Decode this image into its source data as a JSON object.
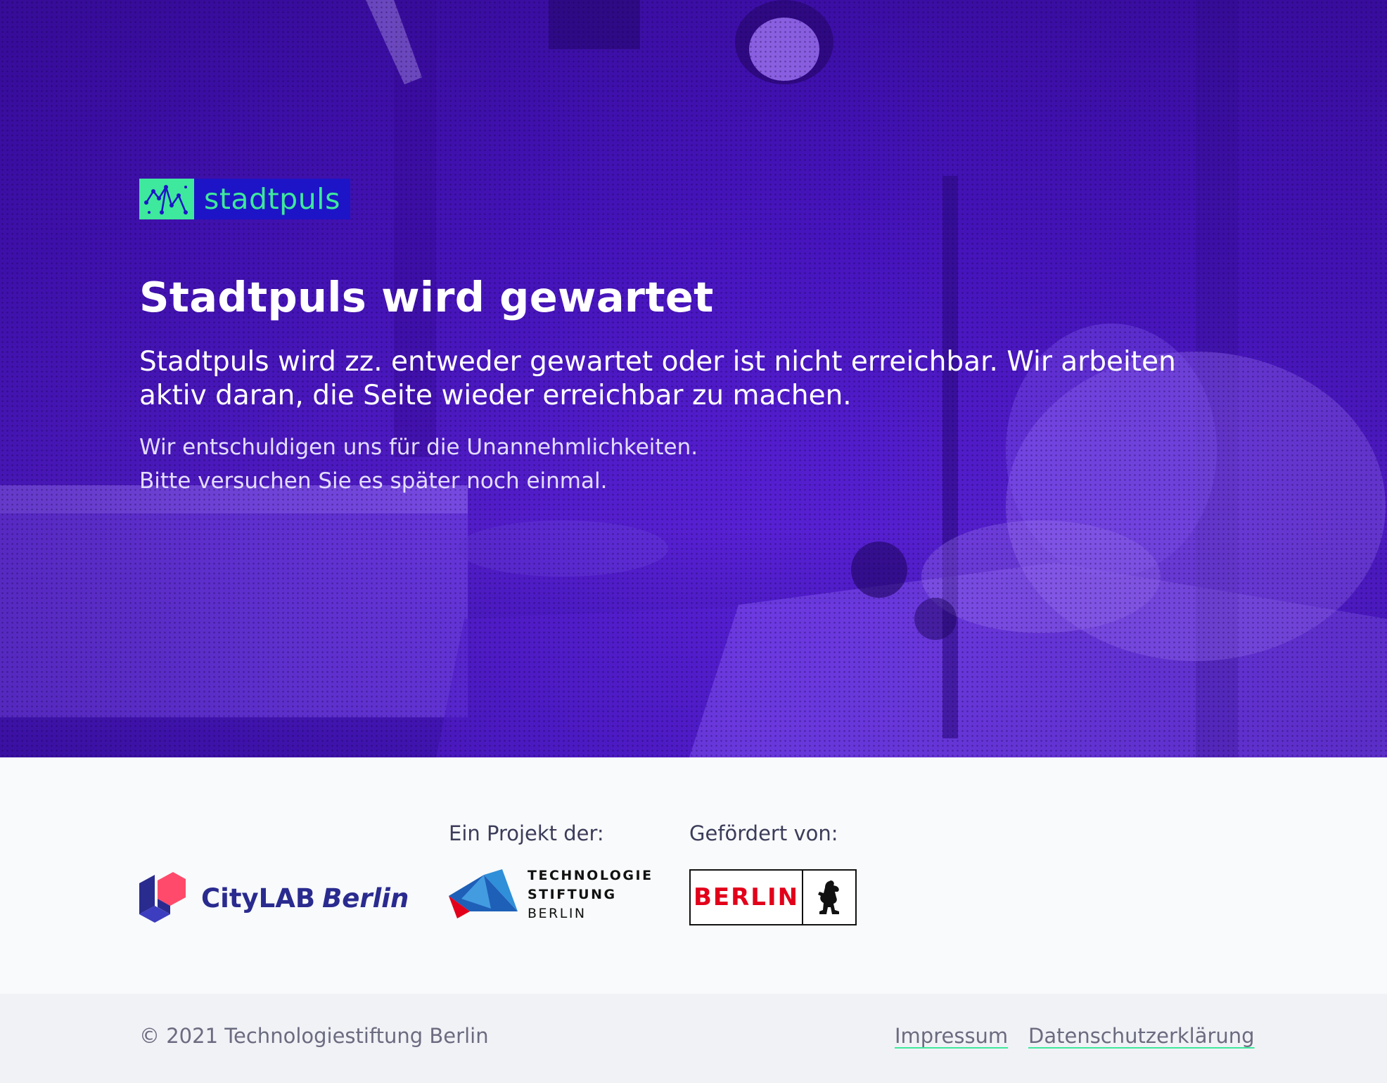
{
  "brand": {
    "name": "stadtpuls",
    "primary_color": "#4a16c4",
    "accent_color": "#3ee89c",
    "logo_bg": "#1d14c7"
  },
  "hero": {
    "title": "Stadtpuls wird gewartet",
    "lead": "Stadtpuls wird zz. entweder gewartet oder ist nicht erreichbar. Wir arbeiten aktiv daran, die Seite wieder erreichbar zu machen.",
    "note_line1": "Wir entschuldigen uns für die Unannehmlichkeiten.",
    "note_line2": "Bitte versuchen Sie es später noch einmal."
  },
  "partners": {
    "project_label": "Ein Projekt der:",
    "funded_label": "Gefördert von:",
    "citylab": {
      "name_part1": "CityLAB",
      "name_part2": "Berlin",
      "icon": "citylab-hexagon-icon"
    },
    "technologiestiftung": {
      "line1": "TECHNOLOGIE",
      "line2": "STIFTUNG",
      "line3": "BERLIN",
      "icon": "tsb-triangle-icon"
    },
    "berlin": {
      "word": "BERLIN",
      "icon": "berlin-bear-icon",
      "color": "#e2001a"
    }
  },
  "footer": {
    "copyright": "© 2021 Technologiestiftung Berlin",
    "links": {
      "impressum": "Impressum",
      "datenschutz": "Datenschutzerklärung"
    }
  }
}
